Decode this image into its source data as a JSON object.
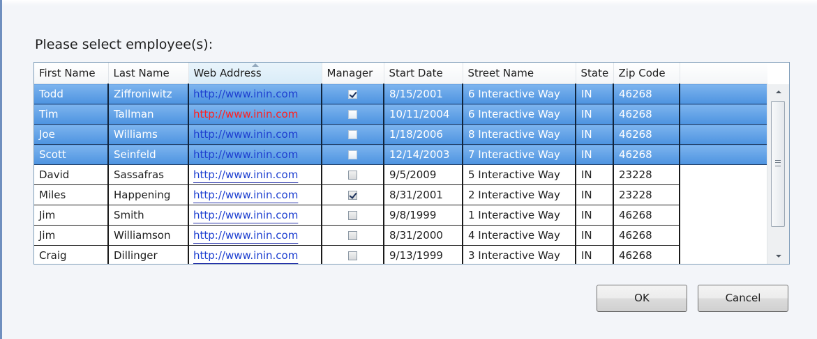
{
  "dialog": {
    "prompt": "Please select employee(s):",
    "ok_label": "OK",
    "cancel_label": "Cancel"
  },
  "grid": {
    "columns": [
      "First Name",
      "Last Name",
      "Web Address",
      "Manager",
      "Start Date",
      "Street Name",
      "State",
      "Zip Code"
    ],
    "sorted_column": "Web Address",
    "rows": [
      {
        "first": "Todd",
        "last": "Ziffroniwitz",
        "web": "http://www.inin.com",
        "manager": true,
        "start": "8/15/2001",
        "street": "6 Interactive Way",
        "state": "IN",
        "zip": "46268",
        "selected": true
      },
      {
        "first": "Tim",
        "last": "Tallman",
        "web": "http://www.inin.com",
        "manager": false,
        "start": "10/11/2004",
        "street": "6 Interactive Way",
        "state": "IN",
        "zip": "46268",
        "selected": true,
        "web_color": "red"
      },
      {
        "first": "Joe",
        "last": "Williams",
        "web": "http://www.inin.com",
        "manager": false,
        "start": "1/18/2006",
        "street": "8 Interactive Way",
        "state": "IN",
        "zip": "46268",
        "selected": true
      },
      {
        "first": "Scott",
        "last": "Seinfeld",
        "web": "http://www.inin.com",
        "manager": false,
        "start": "12/14/2003",
        "street": "7 Interactive Way",
        "state": "IN",
        "zip": "46268",
        "selected": true
      },
      {
        "first": "David",
        "last": "Sassafras",
        "web": "http://www.inin.com",
        "manager": false,
        "start": "9/5/2009",
        "street": "5 Interactive Way",
        "state": "IN",
        "zip": "23228",
        "selected": false
      },
      {
        "first": "Miles",
        "last": "Happening",
        "web": "http://www.inin.com",
        "manager": true,
        "start": "8/31/2001",
        "street": "2 Interactive Way",
        "state": "IN",
        "zip": "23228",
        "selected": false
      },
      {
        "first": "Jim",
        "last": "Smith",
        "web": "http://www.inin.com",
        "manager": false,
        "start": "9/8/1999",
        "street": "1 Interactive Way",
        "state": "IN",
        "zip": "46268",
        "selected": false
      },
      {
        "first": "Jim",
        "last": "Williamson",
        "web": "http://www.inin.com",
        "manager": false,
        "start": "8/31/2000",
        "street": "4 Interactive Way",
        "state": "IN",
        "zip": "46268",
        "selected": false
      },
      {
        "first": "Craig",
        "last": "Dillinger",
        "web": "http://www.inin.com",
        "manager": false,
        "start": "9/13/1999",
        "street": "3 Interactive Way",
        "state": "IN",
        "zip": "46268",
        "selected": false
      }
    ]
  },
  "colors": {
    "selection": "#4d93e0",
    "link": "#1d3fd0",
    "link_alert": "#ff1f1f"
  },
  "icons": {
    "scroll_up": "chevron-up-icon",
    "scroll_down": "chevron-down-icon",
    "checkbox": "checkbox-icon"
  }
}
